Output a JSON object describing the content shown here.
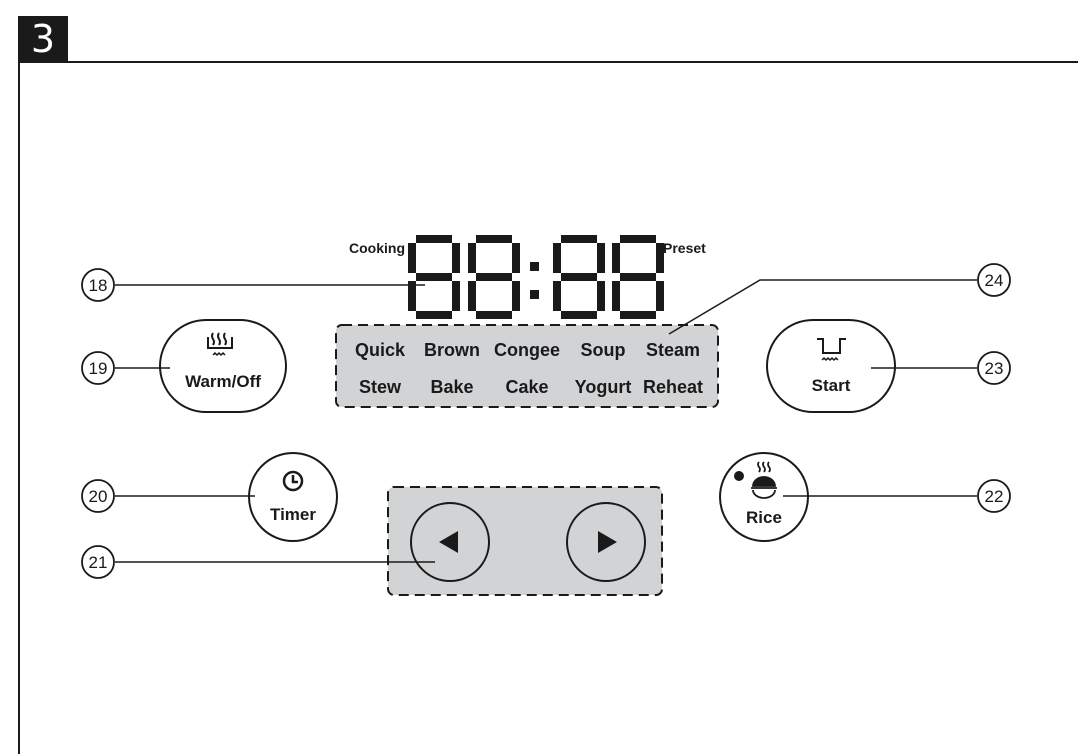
{
  "step": "3",
  "display": {
    "left_label": "Cooking",
    "right_label": "Preset",
    "digits": "88:88"
  },
  "menu_row1": [
    "Quick",
    "Brown",
    "Congee",
    "Soup",
    "Steam"
  ],
  "menu_row2": [
    "Stew",
    "Bake",
    "Cake",
    "Yogurt",
    "Reheat"
  ],
  "buttons": {
    "warm_off": "Warm/Off",
    "start": "Start",
    "timer": "Timer",
    "rice": "Rice"
  },
  "callouts": {
    "c18": "18",
    "c19": "19",
    "c20": "20",
    "c21": "21",
    "c22": "22",
    "c23": "23",
    "c24": "24"
  }
}
